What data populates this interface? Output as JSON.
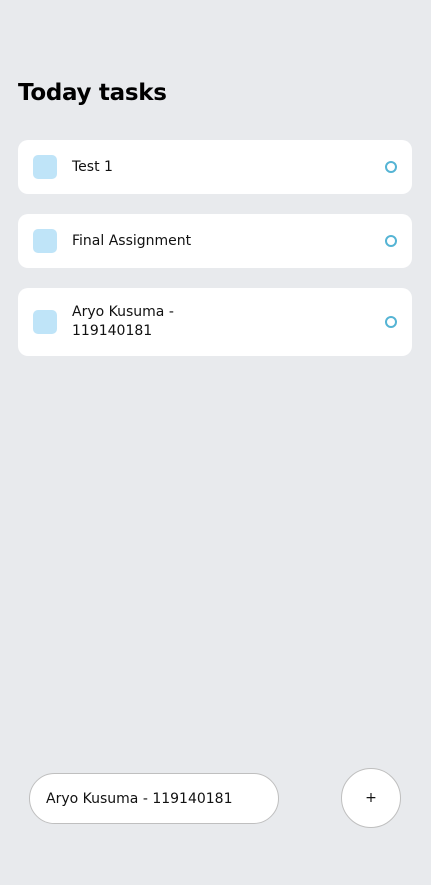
{
  "header": {
    "title": "Today tasks"
  },
  "tasks": [
    {
      "text": "Test 1"
    },
    {
      "text": "Final Assignment"
    },
    {
      "text": "Aryo Kusuma - 119140181"
    }
  ],
  "composer": {
    "input_value": "Aryo Kusuma - 119140181",
    "add_label": "+"
  },
  "colors": {
    "background": "#e8eaed",
    "card": "#ffffff",
    "task_square": "#bfe4f8",
    "task_circle": "#55b4d4"
  }
}
